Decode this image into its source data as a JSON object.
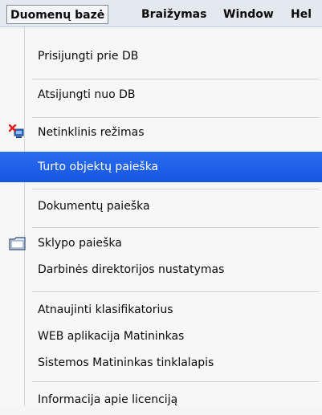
{
  "menubar": {
    "items": [
      {
        "label": "Duomenų bazė",
        "active": true
      },
      {
        "label": "Braižymas"
      },
      {
        "label": "Window"
      },
      {
        "label": "Hel"
      }
    ]
  },
  "dropdown": {
    "items": [
      {
        "label": "Prisijungti prie DB"
      },
      {
        "label": "Atsijungti nuo DB"
      },
      {
        "label": "Netinklinis režimas",
        "icon": "offline-mode-icon"
      },
      {
        "label": "Turto objektų paieška",
        "highlighted": true
      },
      {
        "label": "Dokumentų paieška"
      },
      {
        "label": "Sklypo paieška",
        "icon": "folder-icon"
      },
      {
        "label": "Darbinės direktorijos nustatymas"
      },
      {
        "label": "Atnaujinti klasifikatorius"
      },
      {
        "label": "WEB aplikacija Matininkas"
      },
      {
        "label": "Sistemos Matininkas tinklalapis"
      },
      {
        "label": "Informacija apie licenciją"
      }
    ]
  },
  "colors": {
    "highlight": "#1f5fe8",
    "menubar_bg": "#e4e9ef",
    "menu_bg": "#f7f7f7"
  }
}
